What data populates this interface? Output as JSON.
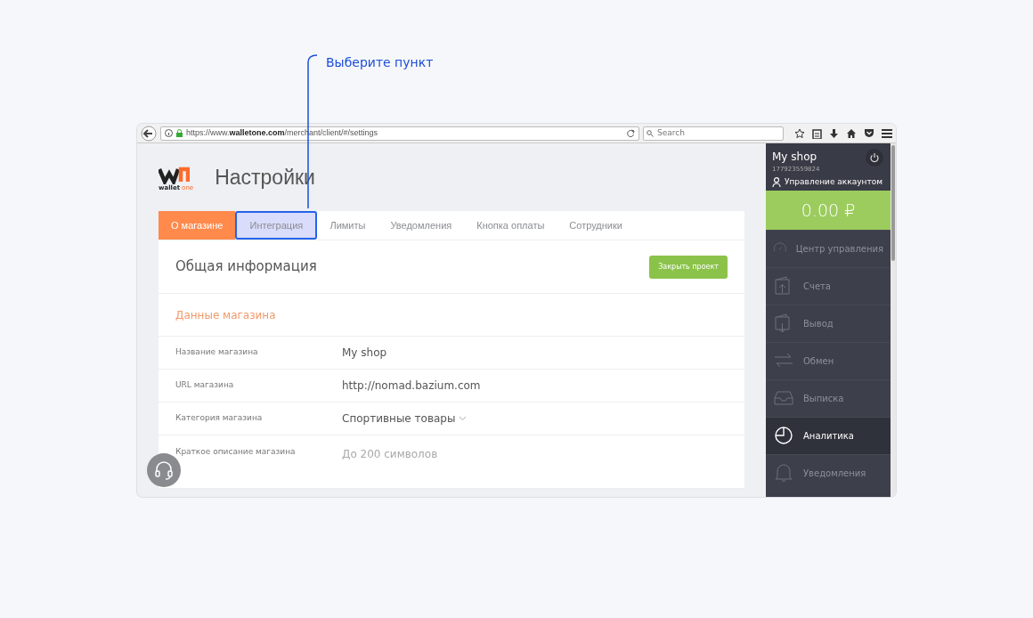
{
  "callout": {
    "text": "Выберите пункт"
  },
  "browser": {
    "url": "https://www.**walletone.com**/merchant/client/#/settings",
    "search_placeholder": "Search"
  },
  "header": {
    "logo_word": "wallet",
    "logo_word_2": "one",
    "title": "Настройки"
  },
  "tabs": [
    {
      "label": "О магазине",
      "selected": true,
      "highlighted": false
    },
    {
      "label": "Интеграция",
      "selected": false,
      "highlighted": true
    },
    {
      "label": "Лимиты",
      "selected": false,
      "highlighted": false
    },
    {
      "label": "Уведомления",
      "selected": false,
      "highlighted": false
    },
    {
      "label": "Кнопка оплаты",
      "selected": false,
      "highlighted": false
    },
    {
      "label": "Сотрудники",
      "selected": false,
      "highlighted": false
    }
  ],
  "card": {
    "title": "Общая информация",
    "button": "Закрыть проект",
    "section": "Данные магазина",
    "fields": [
      {
        "label": "Название магазина",
        "kind": "text",
        "value": "My shop"
      },
      {
        "label": "URL магазина",
        "kind": "text",
        "value": "http://nomad.bazium.com"
      },
      {
        "label": "Категория магазина",
        "kind": "select",
        "value": "Спортивные товары"
      },
      {
        "label": "Краткое описание магазина",
        "kind": "textarea",
        "placeholder": "До 200 символов"
      }
    ]
  },
  "sidebar": {
    "shop_name": "My shop",
    "shop_id": "177923559824",
    "account_link": "Управление аккаунтом",
    "balance": "0.00 ₽",
    "items": [
      {
        "label": "Центр управления",
        "selected": false
      },
      {
        "label": "Счета",
        "selected": false
      },
      {
        "label": "Вывод",
        "selected": false
      },
      {
        "label": "Обмен",
        "selected": false
      },
      {
        "label": "Выписка",
        "selected": false
      },
      {
        "label": "Аналитика",
        "selected": true
      },
      {
        "label": "Уведомления",
        "selected": false
      }
    ]
  }
}
